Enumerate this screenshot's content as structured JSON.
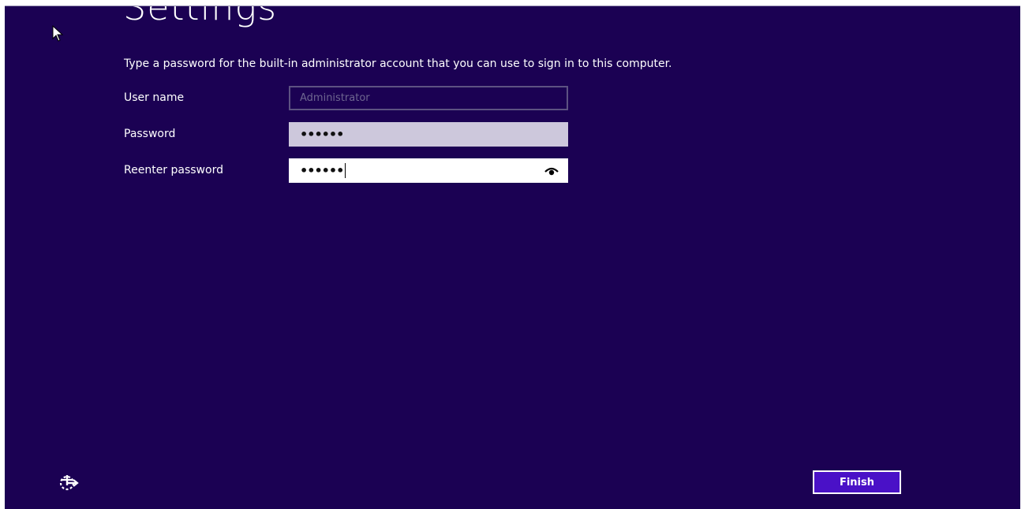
{
  "page": {
    "title": "Settings",
    "instruction": "Type a password for the built-in administrator account that you can use to sign in to this computer."
  },
  "fields": {
    "username": {
      "label": "User name",
      "value": "Administrator"
    },
    "password": {
      "label": "Password",
      "masked_value": "••••••"
    },
    "reenter": {
      "label": "Reenter password",
      "masked_value": "••••••",
      "reveal_icon": "eye-icon"
    }
  },
  "footer": {
    "ease_of_access_icon": "ease-of-access-icon",
    "finish_label": "Finish"
  },
  "colors": {
    "background": "#1b0153",
    "accent_button": "#4a11c7",
    "text": "#ffffff"
  }
}
